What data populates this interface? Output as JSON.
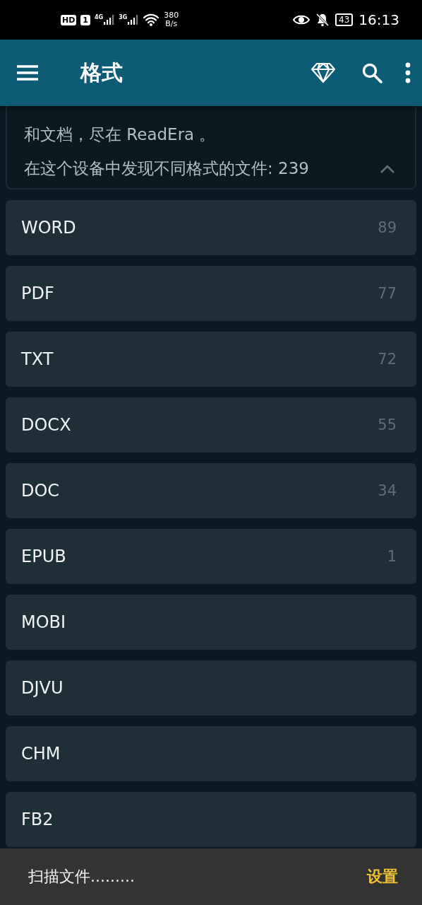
{
  "status_bar": {
    "left": [
      {
        "kind": "hd",
        "text": "HD"
      },
      {
        "kind": "sim",
        "text": "1"
      },
      {
        "kind": "signal",
        "text": "4G"
      },
      {
        "kind": "signal",
        "text": "3G"
      },
      {
        "kind": "wifi"
      },
      {
        "kind": "speed",
        "text": "380",
        "unit": "B/s"
      }
    ],
    "right": [
      {
        "kind": "eye"
      },
      {
        "kind": "bell-off"
      },
      {
        "kind": "battery",
        "text": "43"
      },
      {
        "kind": "time",
        "text": "16:13"
      }
    ]
  },
  "app_bar": {
    "title": "格式"
  },
  "info_card": {
    "description": "和文档，尽在 ReadEra 。",
    "summary": "在这个设备中发现不同格式的文件: 239",
    "expanded": true
  },
  "formats": [
    {
      "name": "WORD",
      "count": "89"
    },
    {
      "name": "PDF",
      "count": "77"
    },
    {
      "name": "TXT",
      "count": "72"
    },
    {
      "name": "DOCX",
      "count": "55"
    },
    {
      "name": "DOC",
      "count": "34"
    },
    {
      "name": "EPUB",
      "count": "1"
    },
    {
      "name": "MOBI"
    },
    {
      "name": "DJVU"
    },
    {
      "name": "CHM"
    },
    {
      "name": "FB2"
    }
  ],
  "snackbar": {
    "message": "扫描文件.........",
    "action": "设置"
  }
}
